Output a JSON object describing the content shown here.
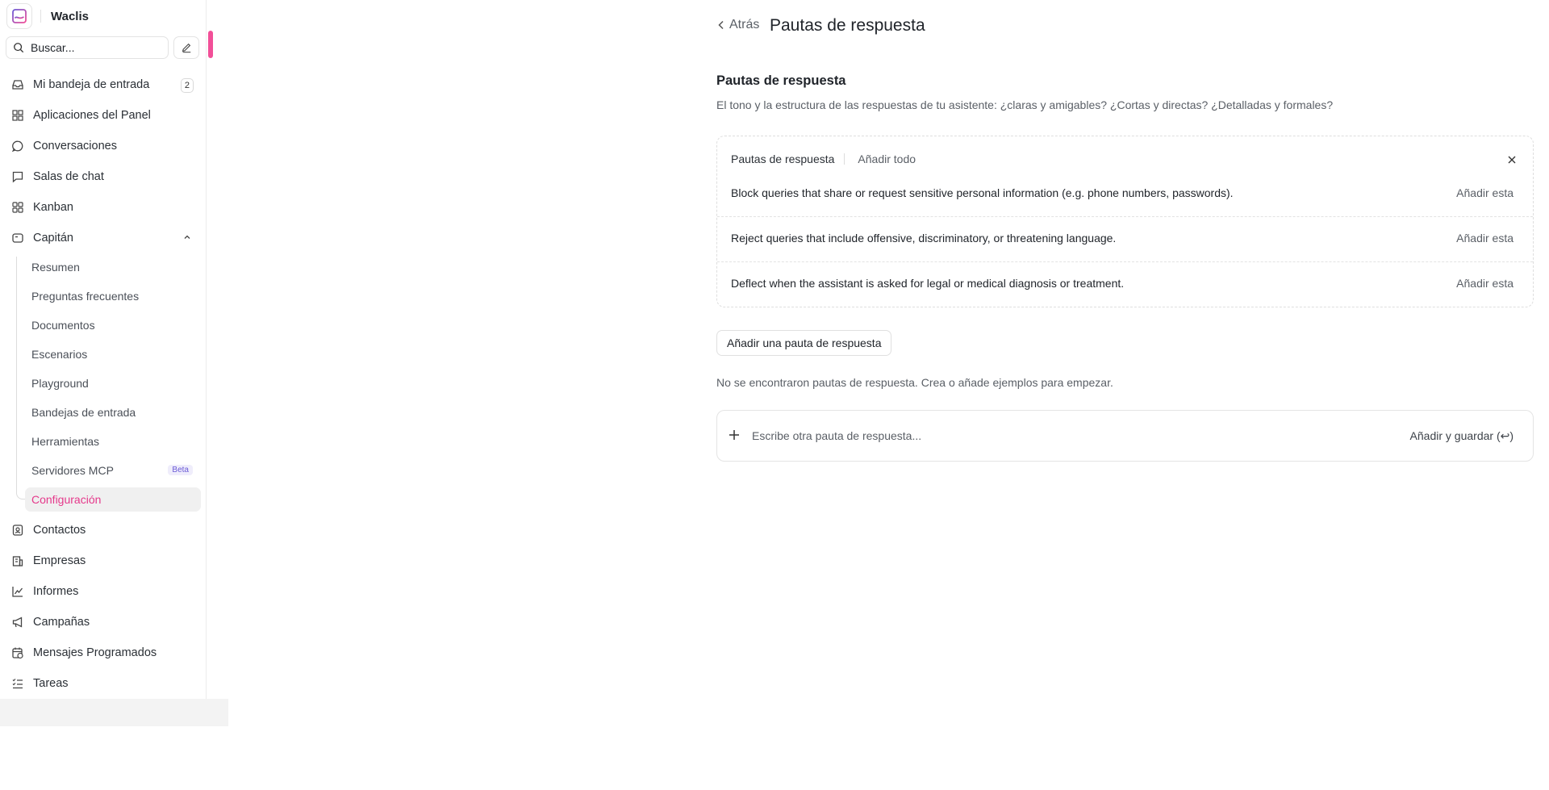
{
  "sidebar": {
    "brand_name": "Waclis",
    "search_placeholder": "Buscar...",
    "items": [
      {
        "label": "Mi bandeja de entrada",
        "badge": "2",
        "icon": "inbox-icon"
      },
      {
        "label": "Aplicaciones del Panel",
        "icon": "apps-grid-icon"
      },
      {
        "label": "Conversaciones",
        "icon": "chat-bubble-icon"
      },
      {
        "label": "Salas de chat",
        "icon": "message-square-icon"
      },
      {
        "label": "Kanban",
        "icon": "kanban-icon"
      },
      {
        "label": "Capitán",
        "icon": "captain-icon"
      }
    ],
    "captain_sub": [
      {
        "label": "Resumen"
      },
      {
        "label": "Preguntas frecuentes"
      },
      {
        "label": "Documentos"
      },
      {
        "label": "Escenarios"
      },
      {
        "label": "Playground"
      },
      {
        "label": "Bandejas de entrada"
      },
      {
        "label": "Herramientas"
      },
      {
        "label": "Servidores MCP",
        "tag": "Beta"
      },
      {
        "label": "Configuración",
        "active": true
      }
    ],
    "bottom_items": [
      {
        "label": "Contactos",
        "icon": "contact-icon"
      },
      {
        "label": "Empresas",
        "icon": "building-icon"
      },
      {
        "label": "Informes",
        "icon": "chart-line-icon"
      },
      {
        "label": "Campañas",
        "icon": "megaphone-icon"
      },
      {
        "label": "Mensajes Programados",
        "icon": "calendar-clock-icon"
      },
      {
        "label": "Tareas",
        "icon": "tasks-list-icon"
      }
    ]
  },
  "header": {
    "back_label": "Atrás",
    "title": "Pautas de respuesta"
  },
  "section": {
    "title": "Pautas de respuesta",
    "description": "El tono y la estructura de las respuestas de tu asistente: ¿claras y amigables? ¿Cortas y directas? ¿Detalladas y formales?"
  },
  "suggestions": {
    "heading": "Pautas de respuesta",
    "add_all_label": "Añadir todo",
    "add_one_label": "Añadir esta",
    "items": [
      "Block queries that share or request sensitive personal information (e.g. phone numbers, passwords).",
      "Reject queries that include offensive, discriminatory, or threatening language.",
      "Deflect when the assistant is asked for legal or medical diagnosis or treatment."
    ]
  },
  "add_button_label": "Añadir una pauta de respuesta",
  "empty_message": "No se encontraron pautas de respuesta. Crea o añade ejemplos para empezar.",
  "new_input": {
    "placeholder": "Escribe otra pauta de respuesta...",
    "save_label": "Añadir y guardar (↩)"
  },
  "colors": {
    "accent": "#e5398b",
    "handle": "#f24f98"
  }
}
